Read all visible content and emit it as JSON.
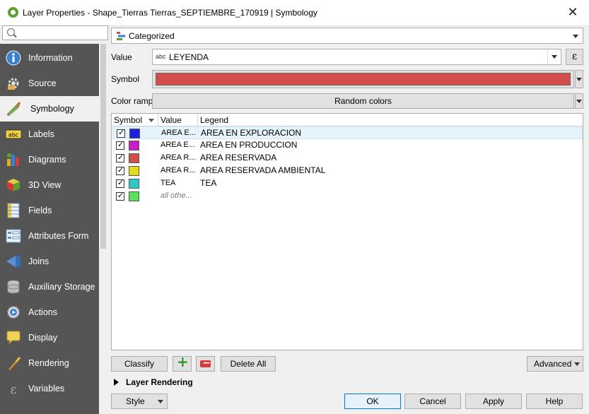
{
  "window": {
    "title": "Layer Properties - Shape_Tierras Tierras_SEPTIEMBRE_170919 | Symbology",
    "close": "✕"
  },
  "search": {
    "placeholder": ""
  },
  "sidebar": {
    "items": [
      {
        "label": "Information",
        "icon": "info-icon"
      },
      {
        "label": "Source",
        "icon": "source-icon"
      },
      {
        "label": "Symbology",
        "icon": "symbology-icon",
        "selected": true
      },
      {
        "label": "Labels",
        "icon": "labels-icon"
      },
      {
        "label": "Diagrams",
        "icon": "diagrams-icon"
      },
      {
        "label": "3D View",
        "icon": "3d-view-icon"
      },
      {
        "label": "Fields",
        "icon": "fields-icon"
      },
      {
        "label": "Attributes Form",
        "icon": "attributes-form-icon"
      },
      {
        "label": "Joins",
        "icon": "joins-icon"
      },
      {
        "label": "Auxiliary Storage",
        "icon": "auxiliary-storage-icon"
      },
      {
        "label": "Actions",
        "icon": "actions-icon"
      },
      {
        "label": "Display",
        "icon": "display-icon"
      },
      {
        "label": "Rendering",
        "icon": "rendering-icon"
      },
      {
        "label": "Variables",
        "icon": "variables-icon"
      }
    ]
  },
  "renderer": {
    "type": "Categorized"
  },
  "value": {
    "label": "Value",
    "type_prefix": "abc",
    "field": "LEYENDA",
    "expr_button": "ε"
  },
  "symbol": {
    "label": "Symbol",
    "color": "#d44d4d"
  },
  "colorramp": {
    "label": "Color ramp",
    "value": "Random colors"
  },
  "table": {
    "headers": {
      "symbol": "Symbol",
      "value": "Value",
      "legend": "Legend"
    },
    "rows": [
      {
        "value": "AREA E...",
        "legend": "AREA EN EXPLORACION",
        "color": "#1f1fe0",
        "checked": true
      },
      {
        "value": "AREA E...",
        "legend": "AREA EN PRODUCCION",
        "color": "#c51ec9",
        "checked": true
      },
      {
        "value": "AREA R...",
        "legend": "AREA RESERVADA",
        "color": "#d44d4d",
        "checked": true
      },
      {
        "value": "AREA R...",
        "legend": "AREA RESERVADA AMBIENTAL",
        "color": "#e3dc1e",
        "checked": true
      },
      {
        "value": "TEA",
        "legend": "TEA",
        "color": "#2cc9c5",
        "checked": true
      },
      {
        "value": "all othe...",
        "legend": "",
        "color": "#5be05b",
        "checked": true
      }
    ]
  },
  "actions": {
    "classify": "Classify",
    "add": "+",
    "remove": "−",
    "delete_all": "Delete All",
    "advanced": "Advanced"
  },
  "layer_rendering": {
    "label": "Layer Rendering"
  },
  "footer": {
    "style": "Style",
    "ok": "OK",
    "cancel": "Cancel",
    "apply": "Apply",
    "help": "Help"
  }
}
